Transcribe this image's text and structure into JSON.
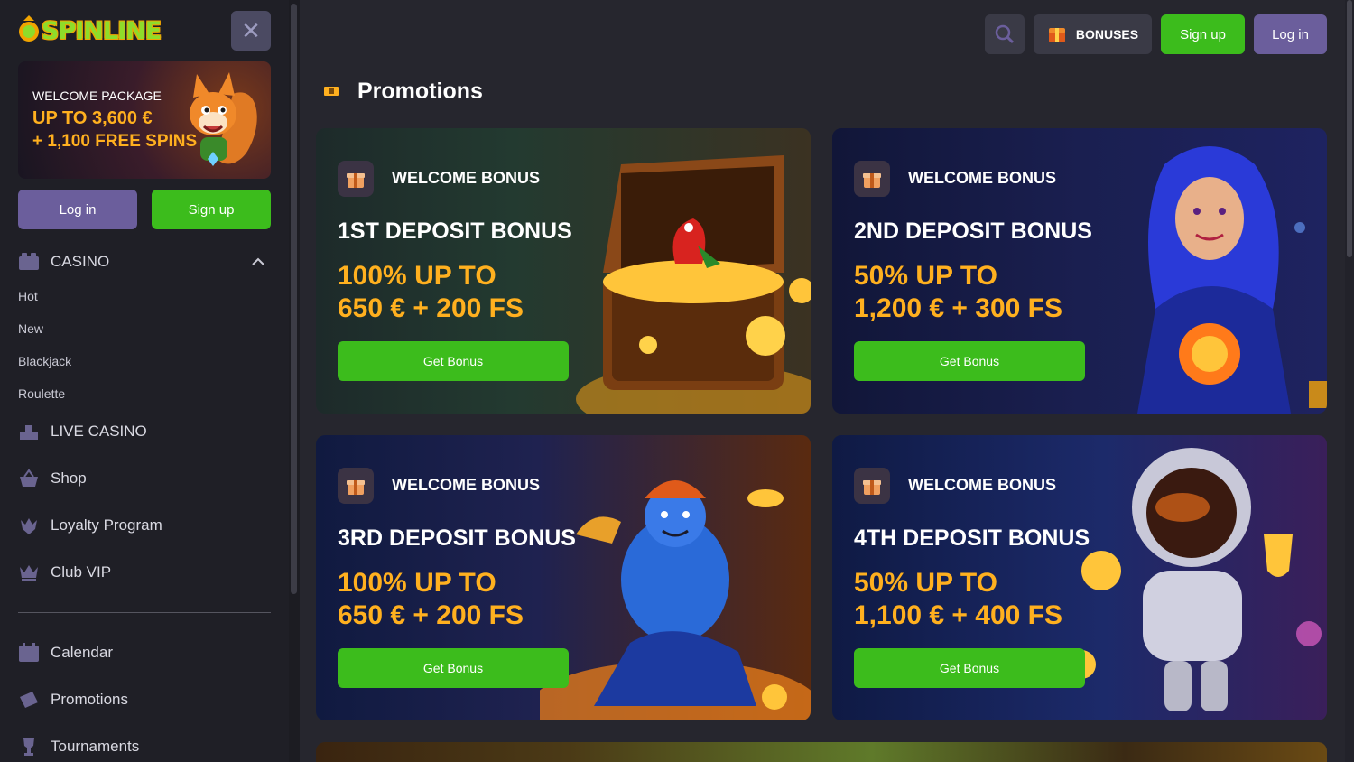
{
  "brand": {
    "logo_text": "SPINLINE",
    "accent_green": "#3cbc1c",
    "accent_purple": "#6b5e9c",
    "accent_gold": "#ffb01f"
  },
  "sidebar": {
    "close_icon": "close-icon",
    "welcome": {
      "title": "WELCOME PACKAGE",
      "line1": "UP TO 3,600 €",
      "line2": "+ 1,100 FREE SPINS"
    },
    "login_label": "Log in",
    "signup_label": "Sign up",
    "casino_label": "CASINO",
    "casino_sub": [
      "Hot",
      "New",
      "Blackjack",
      "Roulette"
    ],
    "items": [
      {
        "label": "LIVE CASINO",
        "icon": "live-casino-icon"
      },
      {
        "label": "Shop",
        "icon": "shop-basket-icon"
      },
      {
        "label": "Loyalty Program",
        "icon": "loyalty-crown-icon"
      },
      {
        "label": "Club VIP",
        "icon": "vip-crown-icon"
      }
    ],
    "items2": [
      {
        "label": "Calendar",
        "icon": "calendar-icon"
      },
      {
        "label": "Promotions",
        "icon": "ticket-icon"
      },
      {
        "label": "Tournaments",
        "icon": "trophy-icon"
      }
    ]
  },
  "header": {
    "search_icon": "search-icon",
    "bonuses_label": "BONUSES",
    "signup_label": "Sign up",
    "login_label": "Log in"
  },
  "main": {
    "title": "Promotions",
    "cards": [
      {
        "tag": "WELCOME BONUS",
        "title": "1ST DEPOSIT BONUS",
        "amount_line1": "100% UP TO",
        "amount_line2": "650 € + 200 FS",
        "cta": "Get Bonus"
      },
      {
        "tag": "WELCOME BONUS",
        "title": "2ND DEPOSIT BONUS",
        "amount_line1": "50% UP TO",
        "amount_line2": "1,200 € + 300 FS",
        "cta": "Get Bonus"
      },
      {
        "tag": "WELCOME BONUS",
        "title": "3RD DEPOSIT BONUS",
        "amount_line1": "100% UP TO",
        "amount_line2": "650 € + 200 FS",
        "cta": "Get Bonus"
      },
      {
        "tag": "WELCOME BONUS",
        "title": "4TH DEPOSIT BONUS",
        "amount_line1": "50% UP TO",
        "amount_line2": "1,100 € + 400 FS",
        "cta": "Get Bonus"
      }
    ]
  }
}
